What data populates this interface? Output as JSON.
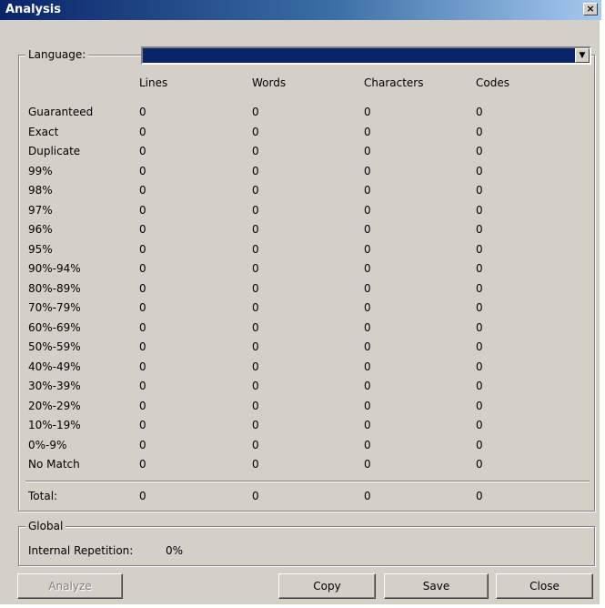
{
  "window": {
    "title": "Analysis",
    "close_glyph": "×"
  },
  "language": {
    "label": "Language:",
    "selected": ""
  },
  "columns": [
    "Lines",
    "Words",
    "Characters",
    "Codes"
  ],
  "rows": [
    {
      "label": "Guaranteed",
      "values": [
        "0",
        "0",
        "0",
        "0"
      ]
    },
    {
      "label": "Exact",
      "values": [
        "0",
        "0",
        "0",
        "0"
      ]
    },
    {
      "label": "Duplicate",
      "values": [
        "0",
        "0",
        "0",
        "0"
      ]
    },
    {
      "label": "99%",
      "values": [
        "0",
        "0",
        "0",
        "0"
      ]
    },
    {
      "label": "98%",
      "values": [
        "0",
        "0",
        "0",
        "0"
      ]
    },
    {
      "label": "97%",
      "values": [
        "0",
        "0",
        "0",
        "0"
      ]
    },
    {
      "label": "96%",
      "values": [
        "0",
        "0",
        "0",
        "0"
      ]
    },
    {
      "label": "95%",
      "values": [
        "0",
        "0",
        "0",
        "0"
      ]
    },
    {
      "label": "90%-94%",
      "values": [
        "0",
        "0",
        "0",
        "0"
      ]
    },
    {
      "label": "80%-89%",
      "values": [
        "0",
        "0",
        "0",
        "0"
      ]
    },
    {
      "label": "70%-79%",
      "values": [
        "0",
        "0",
        "0",
        "0"
      ]
    },
    {
      "label": "60%-69%",
      "values": [
        "0",
        "0",
        "0",
        "0"
      ]
    },
    {
      "label": "50%-59%",
      "values": [
        "0",
        "0",
        "0",
        "0"
      ]
    },
    {
      "label": "40%-49%",
      "values": [
        "0",
        "0",
        "0",
        "0"
      ]
    },
    {
      "label": "30%-39%",
      "values": [
        "0",
        "0",
        "0",
        "0"
      ]
    },
    {
      "label": "20%-29%",
      "values": [
        "0",
        "0",
        "0",
        "0"
      ]
    },
    {
      "label": "10%-19%",
      "values": [
        "0",
        "0",
        "0",
        "0"
      ]
    },
    {
      "label": "0%-9%",
      "values": [
        "0",
        "0",
        "0",
        "0"
      ]
    },
    {
      "label": "No Match",
      "values": [
        "0",
        "0",
        "0",
        "0"
      ]
    }
  ],
  "total": {
    "label": "Total:",
    "values": [
      "0",
      "0",
      "0",
      "0"
    ]
  },
  "global": {
    "label": "Global",
    "internal_repetition_label": "Internal Repetition:",
    "internal_repetition_value": "0%"
  },
  "buttons": {
    "analyze": "Analyze",
    "copy": "Copy",
    "save": "Save",
    "close": "Close"
  },
  "colors": {
    "title_gradient_start": "#0a246a",
    "dialog_face": "#d4d0c8",
    "selection": "#0a246a"
  }
}
